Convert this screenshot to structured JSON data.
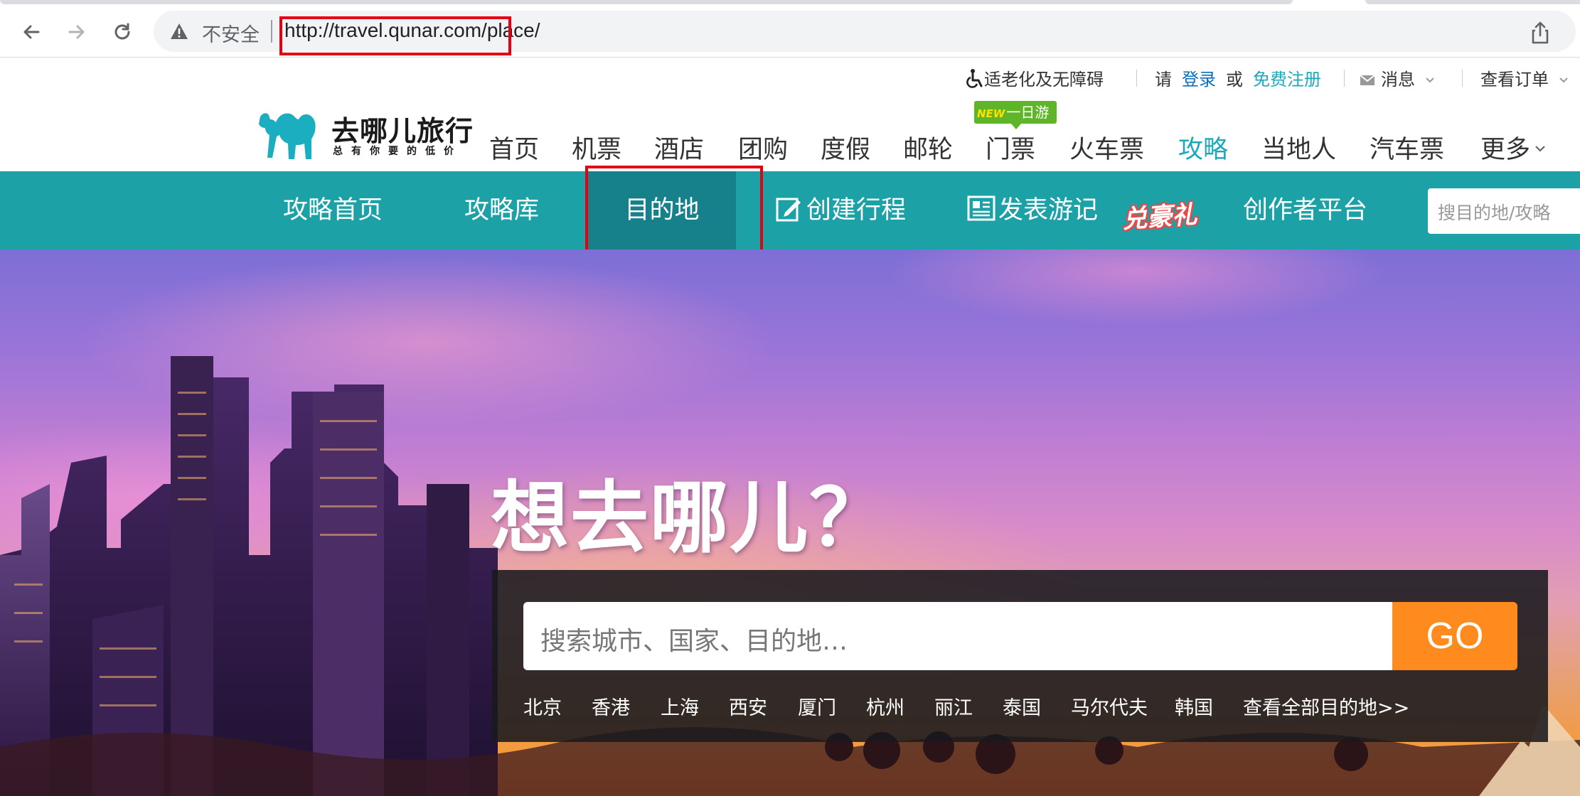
{
  "browser": {
    "insecure_label": "不安全",
    "url": "http://travel.qunar.com/place/"
  },
  "utility": {
    "accessibility": "适老化及无障碍",
    "please": "请",
    "login": "登录",
    "or": "或",
    "register": "免费注册",
    "messages": "消息",
    "orders": "查看订单"
  },
  "logo": {
    "name": "去哪儿旅行",
    "slogan": "总有你要的低价"
  },
  "main_nav": {
    "new_badge_new": "NEW",
    "new_badge_text": "一日游",
    "items": [
      "首页",
      "机票",
      "酒店",
      "团购",
      "度假",
      "邮轮",
      "门票",
      "火车票",
      "攻略",
      "当地人",
      "汽车票",
      "更多"
    ]
  },
  "sub_nav": {
    "items": [
      "攻略首页",
      "攻略库",
      "目的地",
      "创建行程",
      "发表游记",
      "创作者平台"
    ],
    "redeem": "兑豪礼",
    "search_placeholder": "搜目的地/攻略"
  },
  "hero": {
    "title": "想去哪儿？",
    "search_placeholder": "搜索城市、国家、目的地…",
    "go": "GO",
    "quick_links": [
      "北京",
      "香港",
      "上海",
      "西安",
      "厦门",
      "杭州",
      "丽江",
      "泰国",
      "马尔代夫",
      "韩国",
      "查看全部目的地>>"
    ]
  },
  "colors": {
    "brand_teal": "#1ca1a6",
    "active_teal": "#16818a",
    "go_orange": "#ff8b1f",
    "highlight_red": "#e60012"
  }
}
